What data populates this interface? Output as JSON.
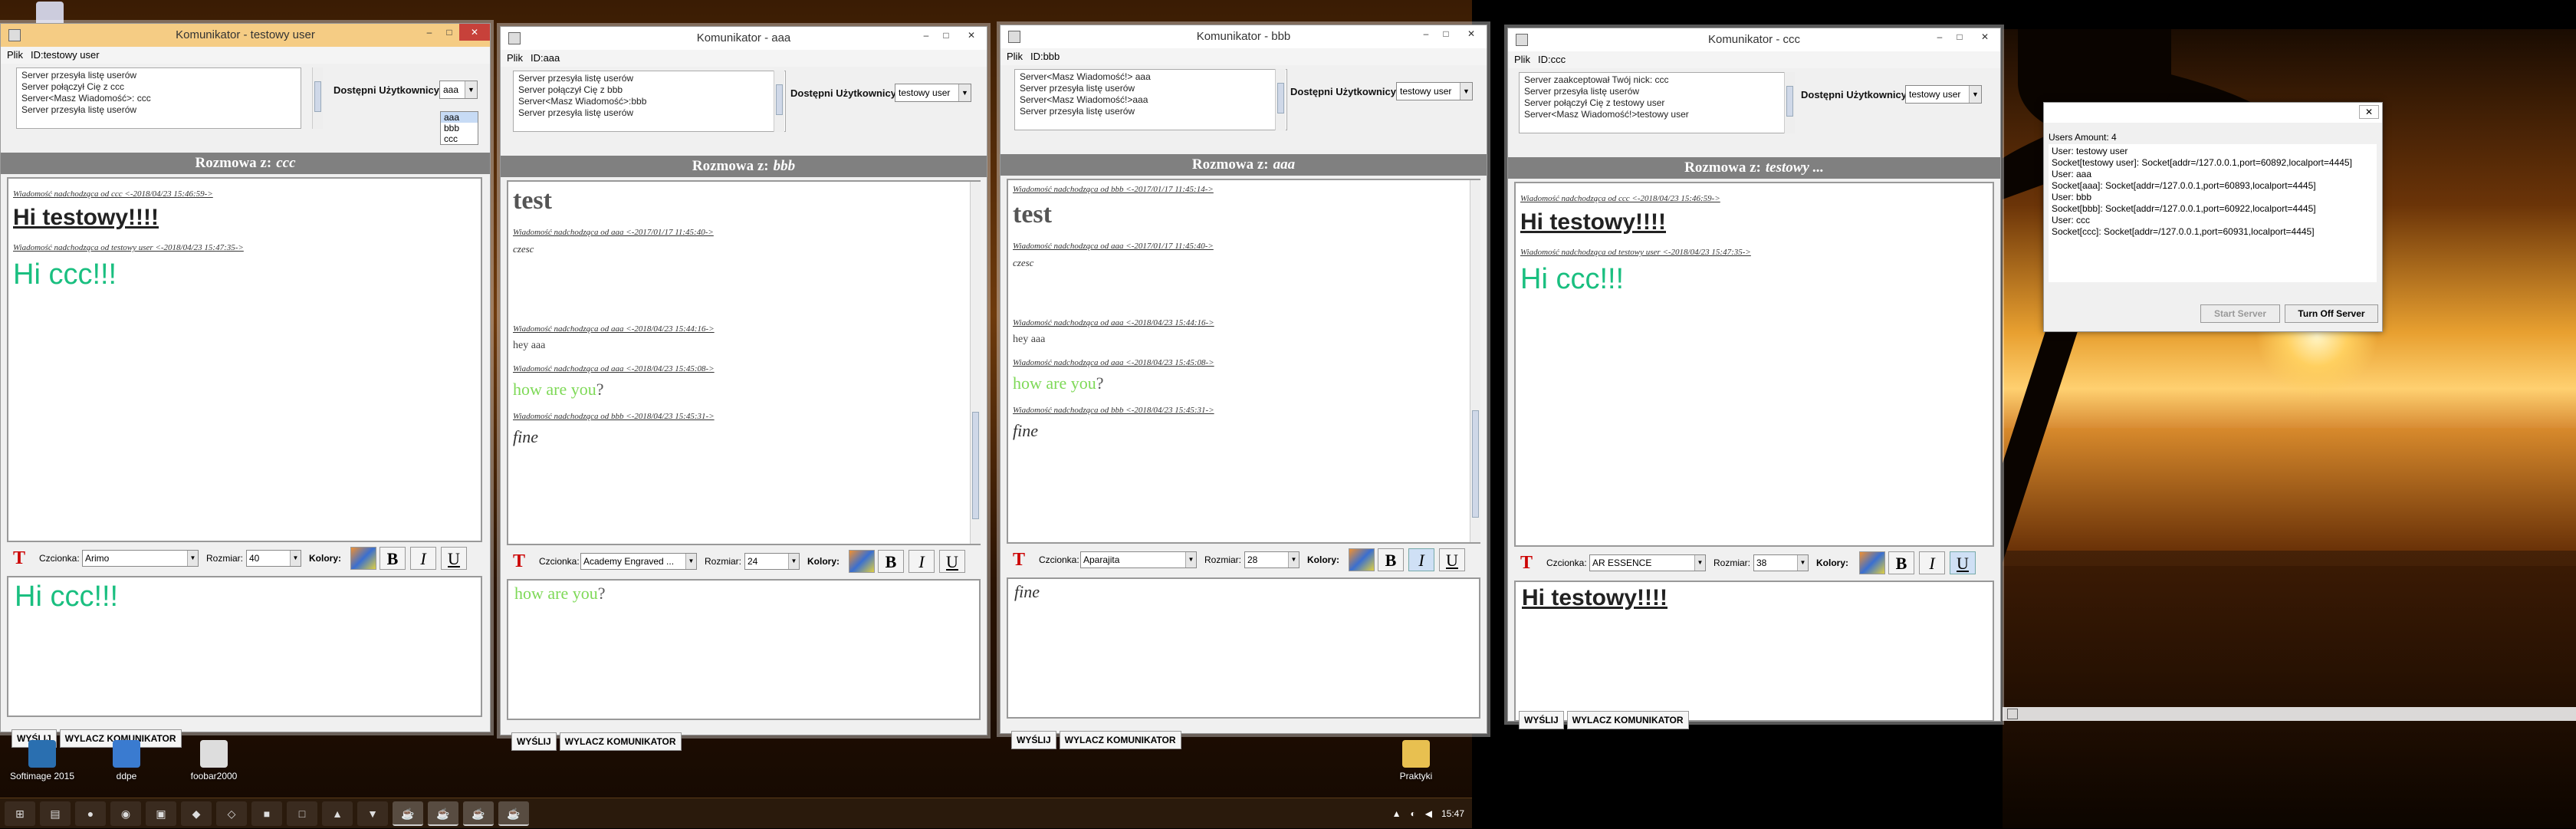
{
  "windows": [
    {
      "title": "Komunikator - testowy user",
      "menu": "Plik",
      "id_label": "ID:testowy user",
      "list": [
        "Server przesyła listę userów",
        "Server połączył Cię z ccc",
        "Server<Masz Wiadomość>: ccc",
        "Server przesyła listę userów"
      ],
      "avail_label": "Dostępni Użytkownicy:",
      "combo": "aaa",
      "conv_label": "Rozmowa z:",
      "conv_with": "ccc",
      "font_label": "Czcionka:",
      "font": "Arimo",
      "size_label": "Rozmiar:",
      "size": "40",
      "colors_label": "Kolory:",
      "send": "WYŚLIJ",
      "off": "WYLACZ KOMUNIKATOR"
    },
    {
      "title": "Komunikator - aaa",
      "menu": "Plik",
      "id_label": "ID:aaa",
      "list": [
        "Server przesyła listę userów",
        "Server połączył Cię z bbb",
        "Server<Masz Wiadomość>:bbb",
        "Server przesyła listę userów"
      ],
      "avail_label": "Dostępni Użytkownicy:",
      "combo": "testowy user",
      "conv_label": "Rozmowa z:",
      "conv_with": "bbb",
      "font_label": "Czcionka:",
      "font": "Academy Engraved ...",
      "size_label": "Rozmiar:",
      "size": "24",
      "colors_label": "Kolory:",
      "send": "WYŚLIJ",
      "off": "WYLACZ KOMUNIKATOR"
    },
    {
      "title": "Komunikator - bbb",
      "menu": "Plik",
      "id_label": "ID:bbb",
      "list": [
        "Server<Masz Wiadomość!> aaa",
        "Server przesyła listę userów",
        "Server<Masz Wiadomość!>aaa",
        "Server przesyła listę userów"
      ],
      "avail_label": "Dostępni Użytkownicy:",
      "combo": "testowy user",
      "conv_label": "Rozmowa z:",
      "conv_with": "aaa",
      "font_label": "Czcionka:",
      "font": "Aparajita",
      "size_label": "Rozmiar:",
      "size": "28",
      "colors_label": "Kolory:",
      "send": "WYŚLIJ",
      "off": "WYLACZ KOMUNIKATOR"
    },
    {
      "title": "Komunikator - ccc",
      "menu": "Plik",
      "id_label": "ID:ccc",
      "list": [
        "Server zaakceptował Twój nick: ccc",
        "Server przesyła listę userów",
        "Server połączył Cię z testowy user",
        "Server<Masz Wiadomość!>testowy user"
      ],
      "avail_label": "Dostępni Użytkownicy:",
      "combo": "testowy user",
      "conv_label": "Rozmowa z:",
      "conv_with": "testowy ...",
      "font_label": "Czcionka:",
      "font": "AR ESSENCE",
      "size_label": "Rozmiar:",
      "size": "38",
      "colors_label": "Kolory:",
      "send": "WYŚLIJ",
      "off": "WYLACZ KOMUNIKATOR"
    }
  ],
  "chat1": {
    "h1": "Wiadomość nadchodząca od ccc <-2018/04/23 15:46:59->",
    "m1": "Hi  testowy!!!!",
    "h2": "Wiadomość nadchodząca od testowy user <-2018/04/23 15:47:35->",
    "m2": "Hi ccc!!!",
    "input": "Hi ccc!!!"
  },
  "chat2": {
    "m0": "test",
    "h1": "Wiadomość nadchodząca od aaa <-2017/01/17 11:45:40->",
    "m1": "czesc",
    "h2": "Wiadomość nadchodząca od aaa <-2018/04/23 15:44:16->",
    "m2": "hey aaa",
    "h3": "Wiadomość nadchodząca od aaa <-2018/04/23 15:45:08->",
    "m3a": "how are you",
    "m3b": "?",
    "h4": "Wiadomość nadchodząca od bbb <-2018/04/23 15:45:31->",
    "m4": "fine",
    "input_a": "how are you",
    "input_b": "?"
  },
  "chat3": {
    "h0": "Wiadomość nadchodząca od bbb <-2017/01/17 11:45:14->",
    "m0": "test",
    "h1": "Wiadomość nadchodząca od aaa <-2017/01/17 11:45:40->",
    "m1": "czesc",
    "h2": "Wiadomość nadchodząca od aaa <-2018/04/23 15:44:16->",
    "m2": "hey aaa",
    "h3": "Wiadomość nadchodząca od aaa <-2018/04/23 15:45:08->",
    "m3a": "how are you",
    "m3b": "?",
    "h4": "Wiadomość nadchodząca od bbb <-2018/04/23 15:45:31->",
    "m4": "fine",
    "input": "fine"
  },
  "chat4": {
    "h1": "Wiadomość nadchodząca od ccc <-2018/04/23 15:46:59->",
    "m1": "Hi  testowy!!!!",
    "h2": "Wiadomość nadchodząca od testowy user <-2018/04/23 15:47:35->",
    "m2": "Hi ccc!!!",
    "input": "Hi  testowy!!!!"
  },
  "dropdown": [
    "aaa",
    "bbb",
    "ccc"
  ],
  "users_window": {
    "count": "Users Amount: 4",
    "lines": [
      "User: testowy user",
      "Socket[testowy user]: Socket[addr=/127.0.0.1,port=60892,localport=4445]",
      "User: aaa",
      "Socket[aaa]: Socket[addr=/127.0.0.1,port=60893,localport=4445]",
      "User: bbb",
      "Socket[bbb]: Socket[addr=/127.0.0.1,port=60922,localport=4445]",
      "User: ccc",
      "Socket[ccc]: Socket[addr=/127.0.0.1,port=60931,localport=4445]"
    ],
    "start": "Start Server",
    "stop": "Turn Off Server"
  },
  "desktop_icons": [
    "Softimage 2015",
    "ddpe",
    "foobar2000",
    "Praktyki"
  ],
  "clock": "15:47",
  "colors": {
    "green": "#1abf80",
    "lightgreen": "#7ed957",
    "gray": "#555555",
    "accent_title": "#f5cc84"
  }
}
